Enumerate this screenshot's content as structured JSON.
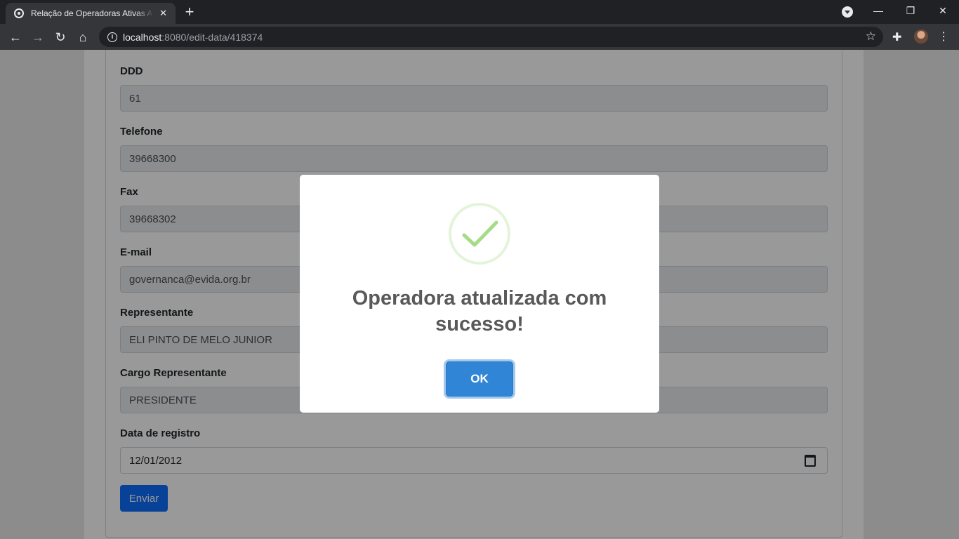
{
  "browser": {
    "tab_title": "Relação de Operadoras Ativas ANS",
    "tab_close": "✕",
    "new_tab": "+",
    "url_host": "localhost",
    "url_rest": ":8080/edit-data/418374",
    "window_minimize": "—",
    "window_restore": "❐",
    "window_close": "✕"
  },
  "form": {
    "fields": [
      {
        "label": "DDD",
        "value": "61"
      },
      {
        "label": "Telefone",
        "value": "39668300"
      },
      {
        "label": "Fax",
        "value": "39668302"
      },
      {
        "label": "E-mail",
        "value": "governanca@evida.org.br"
      },
      {
        "label": "Representante",
        "value": "ELI PINTO DE MELO JUNIOR"
      },
      {
        "label": "Cargo Representante",
        "value": "PRESIDENTE"
      },
      {
        "label": "Data de registro",
        "value": "12/01/2012"
      }
    ],
    "submit_label": "Enviar"
  },
  "modal": {
    "title_line1": "Operadora atualizada com",
    "title_line2": "sucesso!",
    "confirm_label": "OK",
    "icon": "success-check-icon",
    "icon_color": "#a5dc86"
  }
}
